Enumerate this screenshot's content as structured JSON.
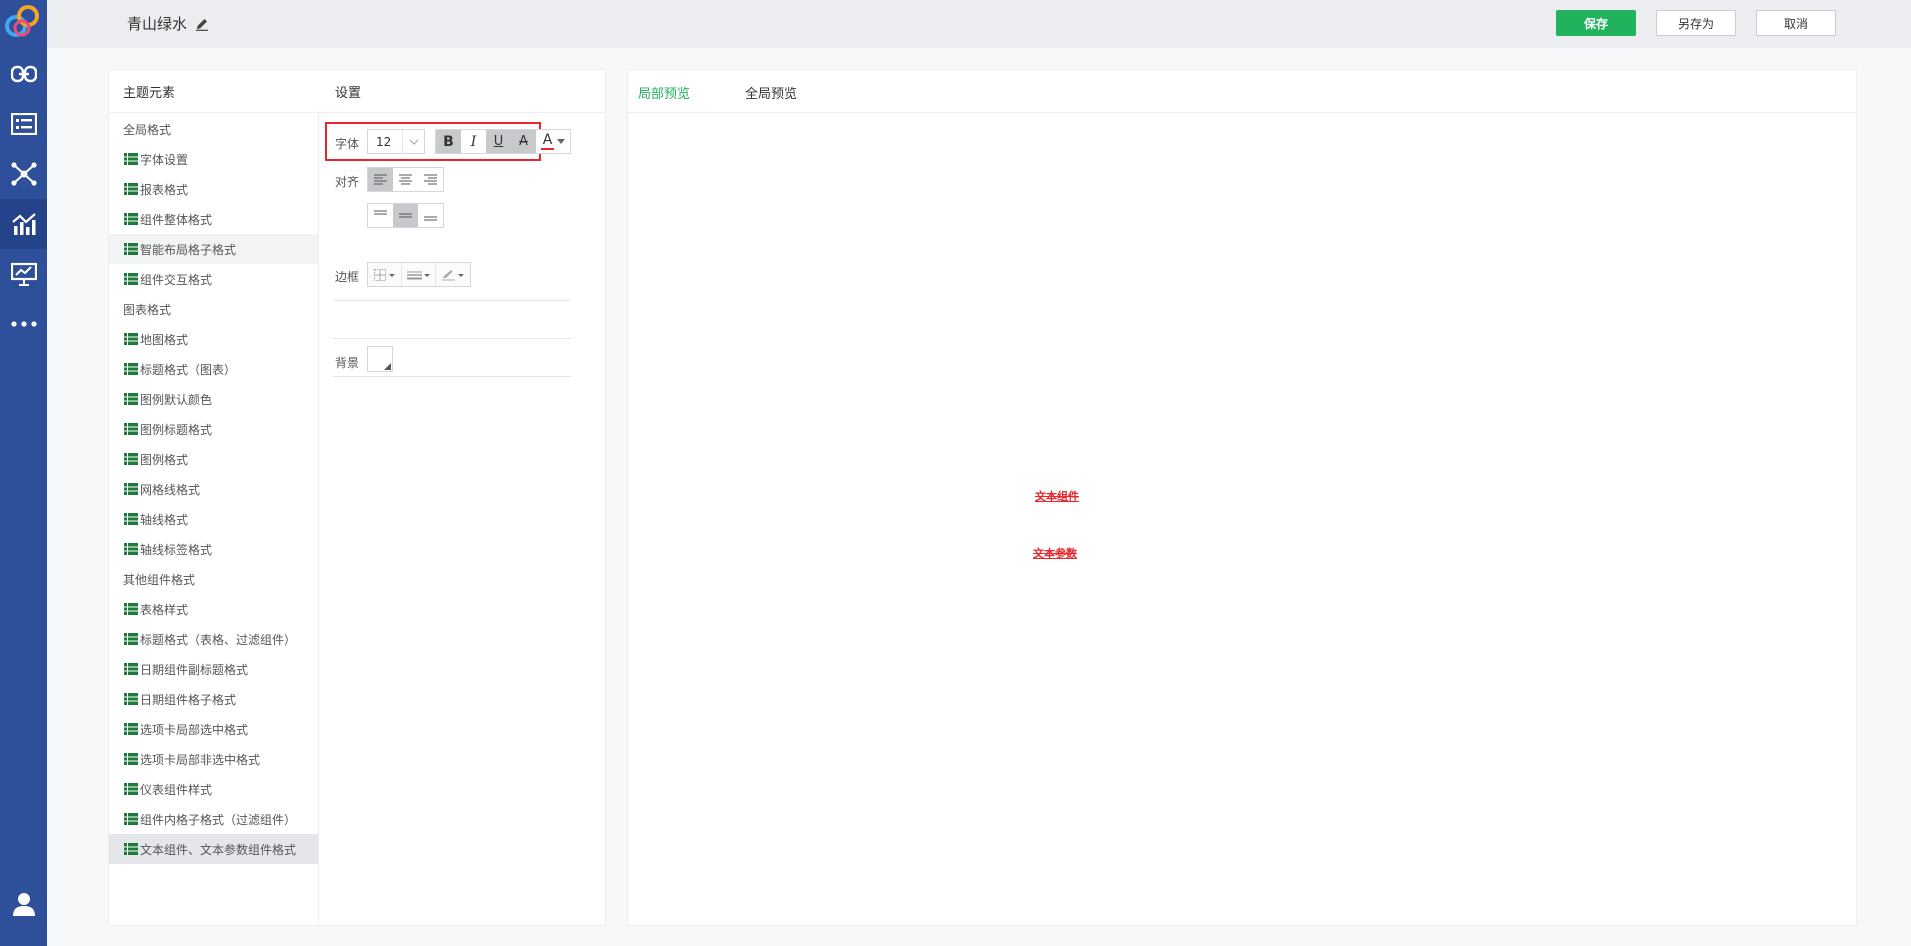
{
  "header": {
    "title": "青山绿水",
    "save": "保存",
    "save_as": "另存为",
    "cancel": "取消"
  },
  "left_panel": {
    "elements_title": "主题元素",
    "settings_title": "设置"
  },
  "tree": [
    {
      "type": "group",
      "label": "全局格式"
    },
    {
      "type": "leaf",
      "label": "字体设置"
    },
    {
      "type": "leaf",
      "label": "报表格式"
    },
    {
      "type": "leaf",
      "label": "组件整体格式"
    },
    {
      "type": "leaf",
      "label": "智能布局格子格式",
      "state": "hover"
    },
    {
      "type": "leaf",
      "label": "组件交互格式"
    },
    {
      "type": "group",
      "label": "图表格式"
    },
    {
      "type": "leaf",
      "label": "地图格式"
    },
    {
      "type": "leaf",
      "label": "标题格式（图表）"
    },
    {
      "type": "leaf",
      "label": "图例默认颜色"
    },
    {
      "type": "leaf",
      "label": "图例标题格式"
    },
    {
      "type": "leaf",
      "label": "图例格式"
    },
    {
      "type": "leaf",
      "label": "网格线格式"
    },
    {
      "type": "leaf",
      "label": "轴线格式"
    },
    {
      "type": "leaf",
      "label": "轴线标签格式"
    },
    {
      "type": "group",
      "label": "其他组件格式"
    },
    {
      "type": "leaf",
      "label": "表格样式"
    },
    {
      "type": "leaf",
      "label": "标题格式（表格、过滤组件）"
    },
    {
      "type": "leaf",
      "label": "日期组件副标题格式"
    },
    {
      "type": "leaf",
      "label": "日期组件格子格式"
    },
    {
      "type": "leaf",
      "label": "选项卡局部选中格式"
    },
    {
      "type": "leaf",
      "label": "选项卡局部非选中格式"
    },
    {
      "type": "leaf",
      "label": "仪表组件样式"
    },
    {
      "type": "leaf",
      "label": "组件内格子格式（过滤组件）"
    },
    {
      "type": "leaf",
      "label": "文本组件、文本参数组件格式",
      "state": "selected"
    }
  ],
  "settings": {
    "font_label": "字体",
    "font_size": "12",
    "bold": "B",
    "italic": "I",
    "underline": "U",
    "strike": "A",
    "color_glyph": "A",
    "align_label": "对齐",
    "border_label": "边框",
    "background_label": "背景"
  },
  "preview": {
    "tab_local": "局部预览",
    "tab_global": "全局预览",
    "text_component": "文本组件",
    "text_param": "文本参数"
  },
  "colors": {
    "sidebar": "#2e4f9a",
    "primary": "#22b25d",
    "highlight": "#e8262e",
    "tree_icon": "#1e7a3a"
  }
}
